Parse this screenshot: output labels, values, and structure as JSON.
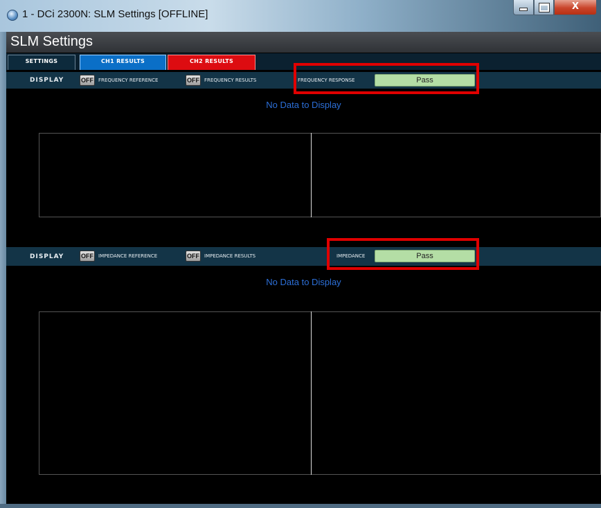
{
  "window": {
    "title": "1 - DCi 2300N: SLM Settings [OFFLINE]",
    "minimize_icon": "minimize-icon",
    "maximize_icon": "maximize-icon",
    "close_glyph": "X"
  },
  "app": {
    "title": "SLM Settings"
  },
  "tabs": [
    {
      "label": "SETTINGS",
      "color": "#0d2a3c"
    },
    {
      "label": "CH1 RESULTS",
      "color": "#0a6fc7"
    },
    {
      "label": "CH2 RESULTS",
      "color": "#dd0c11"
    }
  ],
  "section1": {
    "display_label": "DISPLAY",
    "toggle1": {
      "state": "OFF",
      "label": "FREQUENCY REFERENCE"
    },
    "toggle2": {
      "state": "OFF",
      "label": "FREQUENCY RESULTS"
    },
    "status_label": "FREQUENCY RESPONSE",
    "status_value": "Pass",
    "message": "No Data to Display"
  },
  "section2": {
    "display_label": "DISPLAY",
    "toggle1": {
      "state": "OFF",
      "label": "IMPEDANCE REFERENCE"
    },
    "toggle2": {
      "state": "OFF",
      "label": "IMPEDANCE RESULTS"
    },
    "status_label": "IMPEDANCE",
    "status_value": "Pass",
    "message": "No Data to Display"
  },
  "colors": {
    "pass_bg": "#b4dea5",
    "highlight": "#e00000",
    "message": "#2c6fd8"
  }
}
